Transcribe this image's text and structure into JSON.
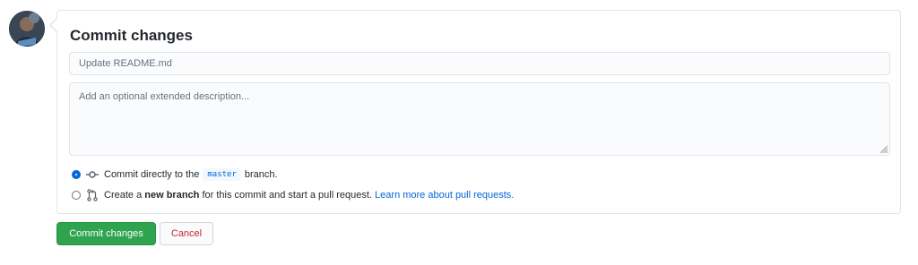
{
  "form": {
    "heading": "Commit changes",
    "summary_placeholder": "Update README.md",
    "description_placeholder": "Add an optional extended description...",
    "options": {
      "direct": {
        "checked": true,
        "icon": "git-commit-icon",
        "prefix": "Commit directly to the",
        "branch": "master",
        "suffix": "branch."
      },
      "new_branch": {
        "checked": false,
        "icon": "git-pull-request-icon",
        "prefix": "Create a",
        "bold": "new branch",
        "middle": "for this commit and start a pull request.",
        "link": "Learn more about pull requests."
      }
    }
  },
  "buttons": {
    "commit": "Commit changes",
    "cancel": "Cancel"
  },
  "colors": {
    "commit_button": "#2ea44f",
    "link": "#0366d6",
    "cancel_text": "#cb2431"
  }
}
